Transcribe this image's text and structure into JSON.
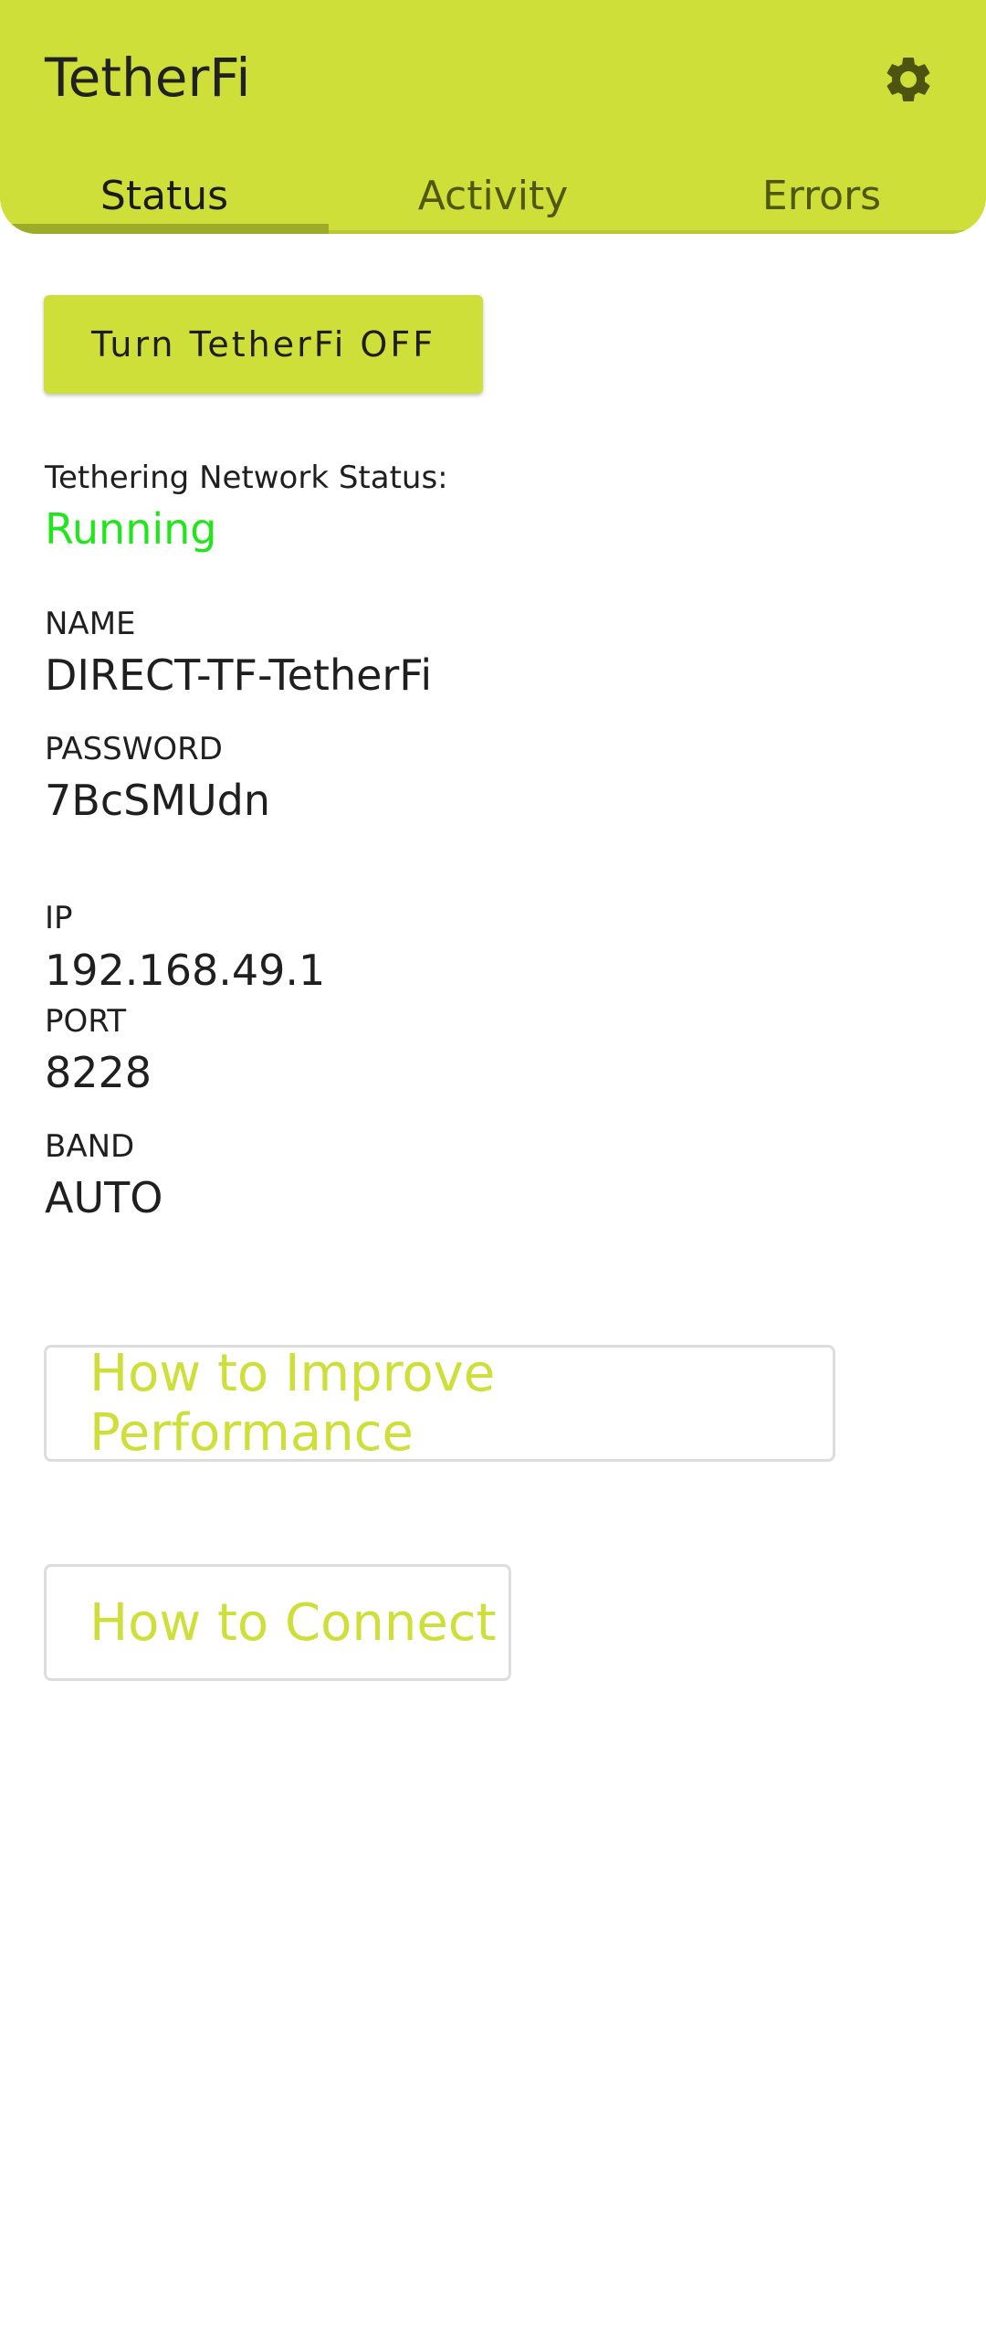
{
  "appbar": {
    "title": "TetherFi",
    "settings_icon": "gear-icon",
    "tabs": [
      {
        "label": "Status",
        "active": true
      },
      {
        "label": "Activity",
        "active": false
      },
      {
        "label": "Errors",
        "active": false
      }
    ]
  },
  "main": {
    "toggle_button_label": "Turn TetherFi OFF",
    "network_status_label": "Tethering Network Status:",
    "network_status_value": "Running",
    "name_label": "NAME",
    "name_value": "DIRECT-TF-TetherFi",
    "password_label": "PASSWORD",
    "password_value": "7BcSMUdn",
    "ip_label": "IP",
    "ip_value": "192.168.49.1",
    "port_label": "PORT",
    "port_value": "8228",
    "band_label": "BAND",
    "band_value": "AUTO",
    "improve_button_label": "How to Improve Performance",
    "connect_button_label": "How to Connect"
  },
  "colors": {
    "accent": "#cddf38",
    "status_running": "#22e61c",
    "tab_indicator": "#9cab28"
  }
}
